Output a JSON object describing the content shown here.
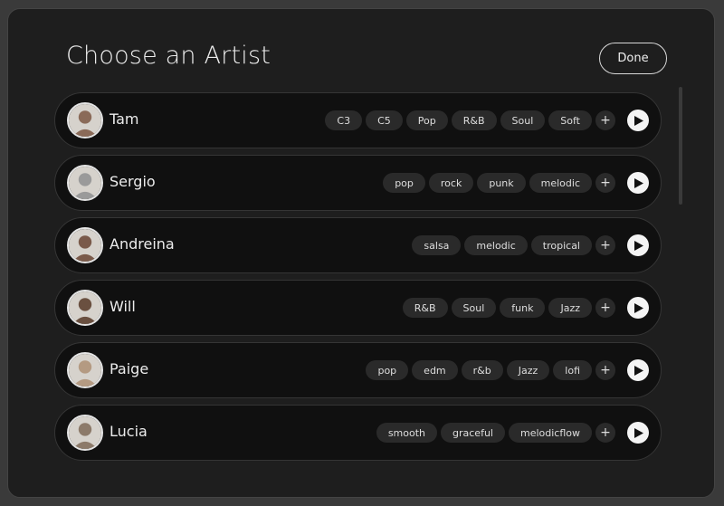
{
  "modal": {
    "title": "Choose an Artist",
    "done_label": "Done"
  },
  "artists": [
    {
      "name": "Tam",
      "tags": [
        "C3",
        "C5",
        "Pop",
        "R&B",
        "Soul",
        "Soft"
      ],
      "add_label": "+",
      "avatar_tone": "#8a6a58"
    },
    {
      "name": "Sergio",
      "tags": [
        "pop",
        "rock",
        "punk",
        "melodic"
      ],
      "add_label": "+",
      "avatar_tone": "#9a9a9a"
    },
    {
      "name": "Andreina",
      "tags": [
        "salsa",
        "melodic",
        "tropical"
      ],
      "add_label": "+",
      "avatar_tone": "#7a5a4a"
    },
    {
      "name": "Will",
      "tags": [
        "R&B",
        "Soul",
        "funk",
        "Jazz"
      ],
      "add_label": "+",
      "avatar_tone": "#6a5040"
    },
    {
      "name": "Paige",
      "tags": [
        "pop",
        "edm",
        "r&b",
        "Jazz",
        "lofi"
      ],
      "add_label": "+",
      "avatar_tone": "#b49a82"
    },
    {
      "name": "Lucia",
      "tags": [
        "smooth",
        "graceful",
        "melodicflow"
      ],
      "add_label": "+",
      "avatar_tone": "#8c7a6a"
    }
  ],
  "colors": {
    "background": "#1e1e1e",
    "row": "#101010",
    "tag": "#2a2a2a",
    "text": "#ececec",
    "play_button": "#f4f4f4"
  },
  "icons": {
    "play": "play-icon",
    "add": "plus-icon"
  }
}
